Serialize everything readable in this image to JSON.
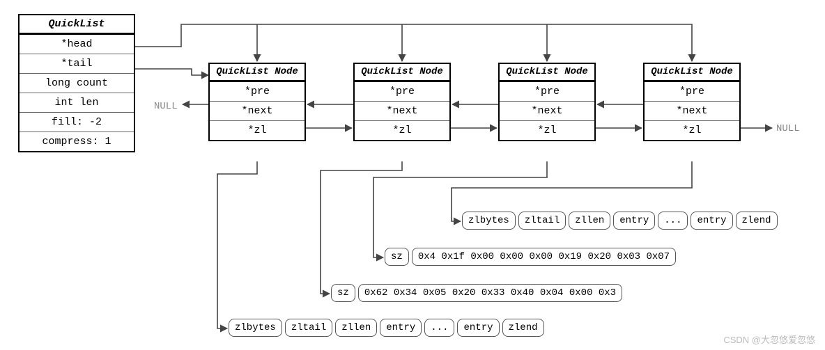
{
  "quicklist": {
    "title": "QuickList",
    "fields": [
      "*head",
      "*tail",
      "long count",
      "int len",
      "fill: -2",
      "compress: 1"
    ]
  },
  "node": {
    "title": "QuickList Node",
    "fields": [
      "*pre",
      "*next",
      "*zl"
    ]
  },
  "labels": {
    "null_left": "NULL",
    "null_right": "NULL"
  },
  "ziplist_full": [
    "zlbytes",
    "zltail",
    "zllen",
    "entry",
    "...",
    "entry",
    "zlend"
  ],
  "sz_row_1": {
    "label": "sz",
    "bytes": "0x4 0x1f 0x00 0x00 0x00 0x19 0x20 0x03 0x07"
  },
  "sz_row_2": {
    "label": "sz",
    "bytes": "0x62 0x34 0x05 0x20 0x33 0x40 0x04 0x00 0x3"
  },
  "watermark": "CSDN @大忽悠爱忽悠"
}
